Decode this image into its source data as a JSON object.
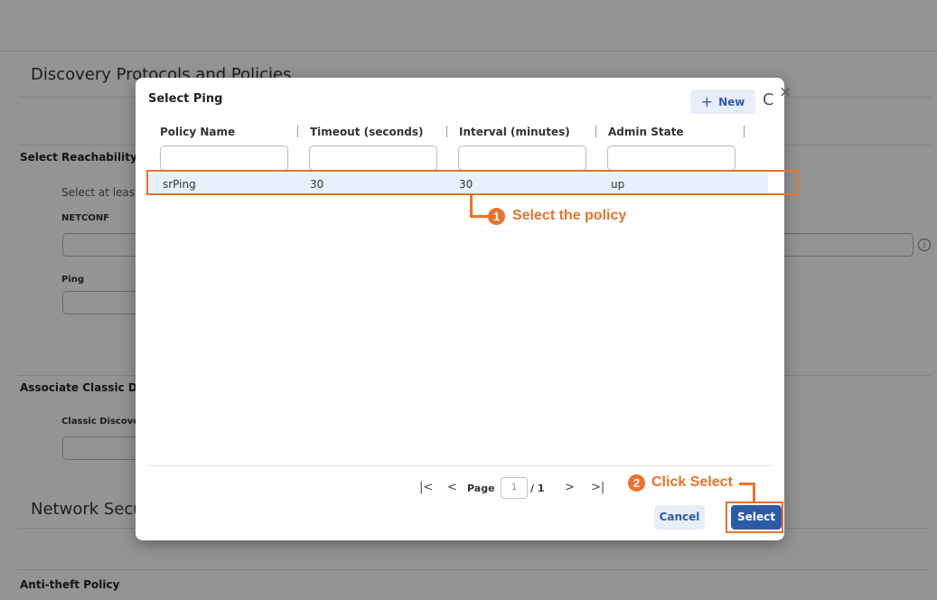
{
  "background": {
    "section_title_1": "Discovery Protocols and Policies",
    "select_reachability_heading": "Select Reachability P",
    "select_at_least_text": "Select at least c",
    "netconf_label": "NETCONF",
    "ping_label": "Ping",
    "associate_heading": "Associate Classic Dis",
    "classic_discovery_label": "Classic Discovery",
    "section_title_2": "Network Secu",
    "anti_theft_heading": "Anti-theft Policy",
    "info_icon_glyph": "i"
  },
  "modal": {
    "title": "Select Ping",
    "new_button_plus": "+",
    "new_button_label": "New",
    "refresh_icon_glyph": "C",
    "close_icon_glyph": "×",
    "columns": [
      "Policy Name",
      "Timeout (seconds)",
      "Interval (minutes)",
      "Admin State"
    ],
    "rows": [
      {
        "policy_name": "srPing",
        "timeout": "30",
        "interval": "30",
        "admin_state": "up"
      }
    ],
    "pagination": {
      "first_glyph": "|<",
      "prev_glyph": "<",
      "page_label": "Page",
      "current_page": "1",
      "total_pages_text": "/ 1",
      "next_glyph": ">",
      "last_glyph": ">|"
    },
    "cancel_label": "Cancel",
    "select_label": "Select"
  },
  "callouts": [
    {
      "number": "1",
      "text": "Select the policy"
    },
    {
      "number": "2",
      "text": "Click Select"
    }
  ],
  "colors": {
    "accent_orange": "#e8732e",
    "primary_blue": "#2c5aa8",
    "light_blue_button": "#e7eefa",
    "selected_row": "#e8f1fb"
  }
}
